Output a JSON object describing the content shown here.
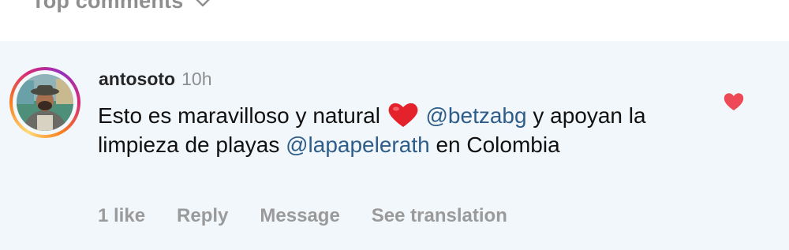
{
  "header": {
    "title": "Top comments"
  },
  "comment": {
    "username": "antosoto",
    "time": "10h",
    "text_part1": "Esto es maravilloso y natural ",
    "mention1": "@betzabg",
    "text_part2": " y apoyan la limpieza de playas ",
    "mention2": "@lapapelerath",
    "text_part3": " en Colombia",
    "emoji": "red-heart-emoji",
    "liked": true
  },
  "actions": {
    "likes": "1 like",
    "reply": "Reply",
    "message": "Message",
    "translate": "See translation"
  },
  "colors": {
    "mention": "#2f5d8a",
    "muted": "#9a9a9a",
    "like": "#ed4956",
    "background": "#f2f7fb"
  }
}
